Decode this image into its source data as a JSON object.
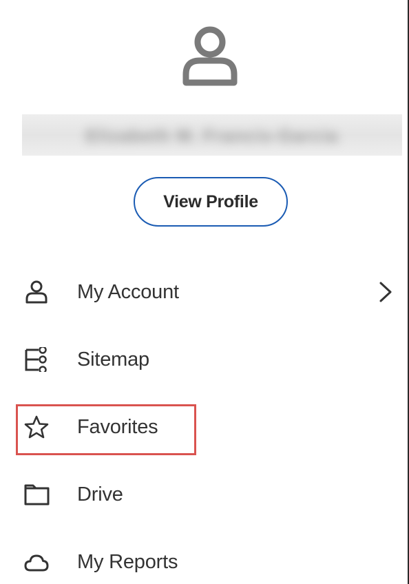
{
  "profile": {
    "user_name": "Elizabeth M. Francis-Garcia",
    "view_profile_label": "View Profile"
  },
  "menu": {
    "items": [
      {
        "label": "My Account",
        "icon": "person-icon",
        "has_submenu": true
      },
      {
        "label": "Sitemap",
        "icon": "sitemap-icon",
        "has_submenu": false
      },
      {
        "label": "Favorites",
        "icon": "star-icon",
        "has_submenu": false,
        "highlighted": true
      },
      {
        "label": "Drive",
        "icon": "folder-icon",
        "has_submenu": false
      },
      {
        "label": "My Reports",
        "icon": "cloud-icon",
        "has_submenu": false
      }
    ]
  },
  "colors": {
    "accent": "#1a5bb3",
    "highlight_border": "#d9534f",
    "icon_gray": "#7a7a7a",
    "text": "#333333"
  }
}
